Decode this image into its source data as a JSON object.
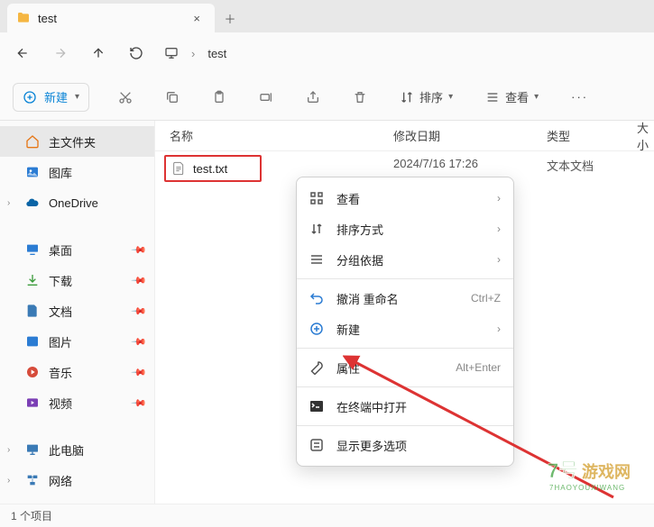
{
  "tab": {
    "title": "test"
  },
  "breadcrumb": {
    "location": "test"
  },
  "toolbar": {
    "new_label": "新建",
    "sort_label": "排序",
    "view_label": "查看"
  },
  "sidebar": {
    "items": [
      {
        "label": "主文件夹",
        "active": true
      },
      {
        "label": "图库"
      },
      {
        "label": "OneDrive",
        "expandable": true
      },
      {
        "label": "桌面",
        "pinned": true,
        "group": 1
      },
      {
        "label": "下载",
        "pinned": true,
        "group": 1
      },
      {
        "label": "文档",
        "pinned": true,
        "group": 1
      },
      {
        "label": "图片",
        "pinned": true,
        "group": 1
      },
      {
        "label": "音乐",
        "pinned": true,
        "group": 1
      },
      {
        "label": "视频",
        "pinned": true,
        "group": 1
      },
      {
        "label": "此电脑",
        "expandable": true,
        "group": 2
      },
      {
        "label": "网络",
        "expandable": true,
        "group": 2
      }
    ]
  },
  "columns": {
    "name": "名称",
    "date": "修改日期",
    "type": "类型",
    "size": "大小"
  },
  "files": [
    {
      "name": "test.txt",
      "date": "2024/7/16 17:26",
      "type": "文本文档"
    }
  ],
  "context_menu": {
    "view": "查看",
    "sort": "排序方式",
    "group": "分组依据",
    "undo": "撤消 重命名",
    "undo_kbd": "Ctrl+Z",
    "new": "新建",
    "props": "属性",
    "props_kbd": "Alt+Enter",
    "terminal": "在终端中打开",
    "more": "显示更多选项"
  },
  "status": {
    "text": "1 个项目"
  },
  "watermark": {
    "line1": "7号游戏网",
    "line2": "7HAOYOUXIWANG"
  }
}
